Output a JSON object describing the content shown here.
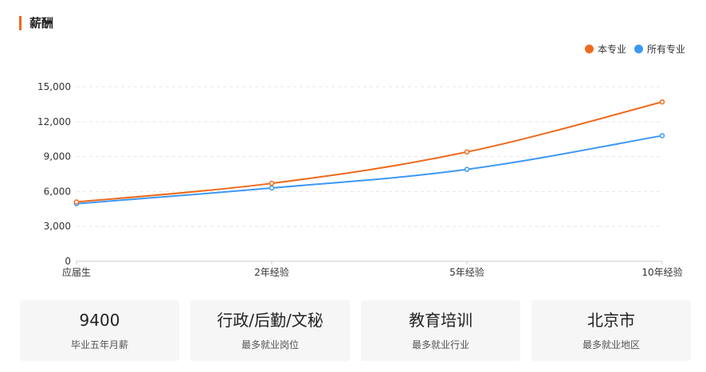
{
  "section": {
    "title": "薪酬"
  },
  "chart_data": {
    "type": "line",
    "categories": [
      "应届生",
      "2年经验",
      "5年经验",
      "10年经验"
    ],
    "series": [
      {
        "name": "本专业",
        "color": "#ee6a1c",
        "values": [
          5100,
          6700,
          9400,
          13700
        ]
      },
      {
        "name": "所有专业",
        "color": "#3d98f5",
        "values": [
          4950,
          6300,
          7900,
          10800
        ]
      }
    ],
    "ylim": [
      0,
      15000
    ],
    "yticks": [
      "0",
      "3,000",
      "6,000",
      "9,000",
      "12,000",
      "15,000"
    ],
    "ytick_values": [
      0,
      3000,
      6000,
      9000,
      12000,
      15000
    ],
    "grid": true,
    "legend_position": "top-right"
  },
  "cards": [
    {
      "value": "9400",
      "label": "毕业五年月薪"
    },
    {
      "value": "行政/后勤/文秘",
      "label": "最多就业岗位"
    },
    {
      "value": "教育培训",
      "label": "最多就业行业"
    },
    {
      "value": "北京市",
      "label": "最多就业地区"
    }
  ]
}
